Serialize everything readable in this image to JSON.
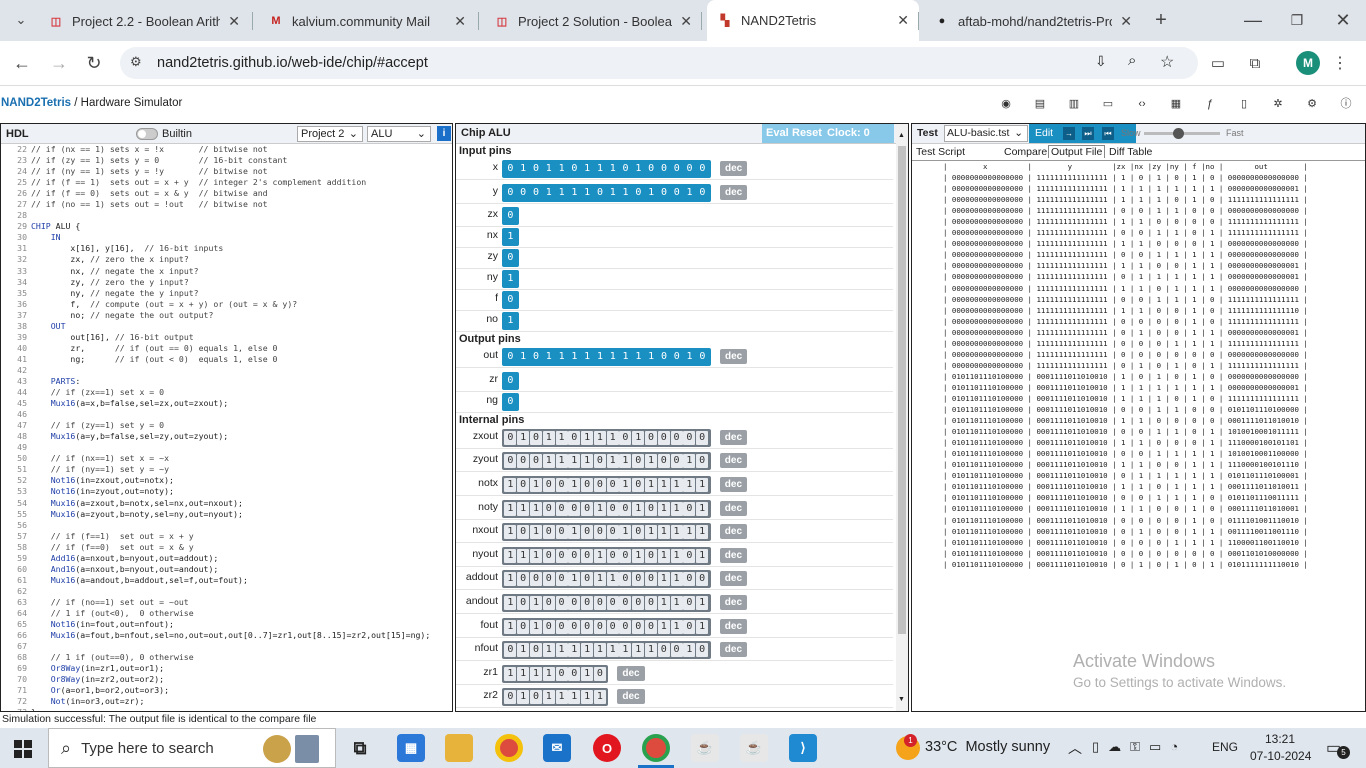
{
  "browser": {
    "tabs": [
      {
        "title": "Project 2.2 - Boolean Arithm",
        "icon": "pdf-icon"
      },
      {
        "title": "kalvium.community Mail",
        "icon": "gmail-icon"
      },
      {
        "title": "Project 2 Solution - Boolean",
        "icon": "pdf-icon"
      },
      {
        "title": "NAND2Tetris",
        "icon": "nand2tetris-icon"
      },
      {
        "title": "aftab-mohd/nand2tetris-Pro",
        "icon": "github-icon"
      }
    ],
    "url": "nand2tetris.github.io/web-ide/chip/#accept",
    "profile_initial": "M"
  },
  "app": {
    "brand": "NAND2Tetris",
    "separator": " / ",
    "subtitle": "Hardware Simulator"
  },
  "hdl": {
    "title": "HDL",
    "builtin_label": "Builtin",
    "project_select": "Project 2",
    "chip_select": "ALU",
    "lines": [
      {
        "n": "22",
        "t": "// if (nx == 1) sets x = !x       // bitwise not"
      },
      {
        "n": "23",
        "t": "// if (zy == 1) sets y = 0        // 16-bit constant"
      },
      {
        "n": "24",
        "t": "// if (ny == 1) sets y = !y       // bitwise not"
      },
      {
        "n": "25",
        "t": "// if (f == 1)  sets out = x + y  // integer 2's complement addition"
      },
      {
        "n": "26",
        "t": "// if (f == 0)  sets out = x & y  // bitwise and"
      },
      {
        "n": "27",
        "t": "// if (no == 1) sets out = !out   // bitwise not"
      },
      {
        "n": "28",
        "t": ""
      },
      {
        "n": "29",
        "t": "CHIP ALU {"
      },
      {
        "n": "30",
        "t": "    IN"
      },
      {
        "n": "31",
        "t": "        x[16], y[16],  // 16-bit inputs"
      },
      {
        "n": "32",
        "t": "        zx, // zero the x input?"
      },
      {
        "n": "33",
        "t": "        nx, // negate the x input?"
      },
      {
        "n": "34",
        "t": "        zy, // zero the y input?"
      },
      {
        "n": "35",
        "t": "        ny, // negate the y input?"
      },
      {
        "n": "36",
        "t": "        f,  // compute (out = x + y) or (out = x & y)?"
      },
      {
        "n": "37",
        "t": "        no; // negate the out output?"
      },
      {
        "n": "38",
        "t": "    OUT"
      },
      {
        "n": "39",
        "t": "        out[16], // 16-bit output"
      },
      {
        "n": "40",
        "t": "        zr,      // if (out == 0) equals 1, else 0"
      },
      {
        "n": "41",
        "t": "        ng;      // if (out < 0)  equals 1, else 0"
      },
      {
        "n": "42",
        "t": ""
      },
      {
        "n": "43",
        "t": "    PARTS:"
      },
      {
        "n": "44",
        "t": "    // if (zx==1) set x = 0"
      },
      {
        "n": "45",
        "t": "    Mux16(a=x,b=false,sel=zx,out=zxout);"
      },
      {
        "n": "46",
        "t": ""
      },
      {
        "n": "47",
        "t": "    // if (zy==1) set y = 0"
      },
      {
        "n": "48",
        "t": "    Mux16(a=y,b=false,sel=zy,out=zyout);"
      },
      {
        "n": "49",
        "t": ""
      },
      {
        "n": "50",
        "t": "    // if (nx==1) set x = ~x"
      },
      {
        "n": "51",
        "t": "    // if (ny==1) set y = ~y"
      },
      {
        "n": "52",
        "t": "    Not16(in=zxout,out=notx);"
      },
      {
        "n": "53",
        "t": "    Not16(in=zyout,out=noty);"
      },
      {
        "n": "54",
        "t": "    Mux16(a=zxout,b=notx,sel=nx,out=nxout);"
      },
      {
        "n": "55",
        "t": "    Mux16(a=zyout,b=noty,sel=ny,out=nyout);"
      },
      {
        "n": "56",
        "t": ""
      },
      {
        "n": "57",
        "t": "    // if (f==1)  set out = x + y"
      },
      {
        "n": "58",
        "t": "    // if (f==0)  set out = x & y"
      },
      {
        "n": "59",
        "t": "    Add16(a=nxout,b=nyout,out=addout);"
      },
      {
        "n": "60",
        "t": "    And16(a=nxout,b=nyout,out=andout);"
      },
      {
        "n": "61",
        "t": "    Mux16(a=andout,b=addout,sel=f,out=fout);"
      },
      {
        "n": "62",
        "t": ""
      },
      {
        "n": "63",
        "t": "    // if (no==1) set out = ~out"
      },
      {
        "n": "64",
        "t": "    // 1 if (out<0),  0 otherwise"
      },
      {
        "n": "65",
        "t": "    Not16(in=fout,out=nfout);"
      },
      {
        "n": "66",
        "t": "    Mux16(a=fout,b=nfout,sel=no,out=out,out[0..7]=zr1,out[8..15]=zr2,out[15]=ng);"
      },
      {
        "n": "67",
        "t": ""
      },
      {
        "n": "68",
        "t": "    // 1 if (out==0), 0 otherwise"
      },
      {
        "n": "69",
        "t": "    Or8Way(in=zr1,out=or1);"
      },
      {
        "n": "70",
        "t": "    Or8Way(in=zr2,out=or2);"
      },
      {
        "n": "71",
        "t": "    Or(a=or1,b=or2,out=or3);"
      },
      {
        "n": "72",
        "t": "    Not(in=or3,out=zr);"
      },
      {
        "n": "73",
        "t": "}"
      }
    ]
  },
  "chip": {
    "title": "Chip ALU",
    "eval": "Eval",
    "reset": "Reset",
    "clock": "Clock: 0",
    "input_title": "Input pins",
    "output_title": "Output pins",
    "internal_title": "Internal pins",
    "dec_label": "dec",
    "inputs": [
      {
        "name": "x",
        "bits": "0101101110100000",
        "dec": true
      },
      {
        "name": "y",
        "bits": "0001111011010010",
        "dec": true
      },
      {
        "name": "zx",
        "bits": "0",
        "dec": false
      },
      {
        "name": "nx",
        "bits": "1",
        "dec": false
      },
      {
        "name": "zy",
        "bits": "0",
        "dec": false
      },
      {
        "name": "ny",
        "bits": "1",
        "dec": false
      },
      {
        "name": "f",
        "bits": "0",
        "dec": false
      },
      {
        "name": "no",
        "bits": "1",
        "dec": false
      }
    ],
    "outputs": [
      {
        "name": "out",
        "bits": "0101111111110010",
        "dec": true
      },
      {
        "name": "zr",
        "bits": "0",
        "dec": false
      },
      {
        "name": "ng",
        "bits": "0",
        "dec": false
      }
    ],
    "internals": [
      {
        "name": "zxout",
        "bits": "0101101110100000"
      },
      {
        "name": "zyout",
        "bits": "0001111011010010"
      },
      {
        "name": "notx",
        "bits": "1010010001011111"
      },
      {
        "name": "noty",
        "bits": "1110000100101101"
      },
      {
        "name": "nxout",
        "bits": "1010010001011111"
      },
      {
        "name": "nyout",
        "bits": "1110000100101101"
      },
      {
        "name": "addout",
        "bits": "1000010110001100"
      },
      {
        "name": "andout",
        "bits": "1010000000001101"
      },
      {
        "name": "fout",
        "bits": "1010000000001101"
      },
      {
        "name": "nfout",
        "bits": "0101111111110010"
      },
      {
        "name": "zr1",
        "bits": "11110010"
      },
      {
        "name": "zr2",
        "bits": "01011111"
      }
    ]
  },
  "test": {
    "title": "Test",
    "file_select": "ALU-basic.tst",
    "edit": "Edit",
    "slow": "Slow",
    "fast": "Fast",
    "speed": 0.45,
    "tabs": [
      "Test Script",
      "Compare File",
      "Output File",
      "Diff Table"
    ],
    "header": "|        x         |        y         |zx |nx |zy |ny | f |no |       out        |",
    "rows": [
      "| 0000000000000000 | 1111111111111111 | 1 | 0 | 1 | 0 | 1 | 0 | 0000000000000000 |",
      "| 0000000000000000 | 1111111111111111 | 1 | 1 | 1 | 1 | 1 | 1 | 0000000000000001 |",
      "| 0000000000000000 | 1111111111111111 | 1 | 1 | 1 | 0 | 1 | 0 | 1111111111111111 |",
      "| 0000000000000000 | 1111111111111111 | 0 | 0 | 1 | 1 | 0 | 0 | 0000000000000000 |",
      "| 0000000000000000 | 1111111111111111 | 1 | 1 | 0 | 0 | 0 | 0 | 1111111111111111 |",
      "| 0000000000000000 | 1111111111111111 | 0 | 0 | 1 | 1 | 0 | 1 | 1111111111111111 |",
      "| 0000000000000000 | 1111111111111111 | 1 | 1 | 0 | 0 | 0 | 1 | 0000000000000000 |",
      "| 0000000000000000 | 1111111111111111 | 0 | 0 | 1 | 1 | 1 | 1 | 0000000000000000 |",
      "| 0000000000000000 | 1111111111111111 | 1 | 1 | 0 | 0 | 1 | 1 | 0000000000000001 |",
      "| 0000000000000000 | 1111111111111111 | 0 | 1 | 1 | 1 | 1 | 1 | 0000000000000001 |",
      "| 0000000000000000 | 1111111111111111 | 1 | 1 | 0 | 1 | 1 | 1 | 0000000000000000 |",
      "| 0000000000000000 | 1111111111111111 | 0 | 0 | 1 | 1 | 1 | 0 | 1111111111111111 |",
      "| 0000000000000000 | 1111111111111111 | 1 | 1 | 0 | 0 | 1 | 0 | 1111111111111110 |",
      "| 0000000000000000 | 1111111111111111 | 0 | 0 | 0 | 0 | 1 | 0 | 1111111111111111 |",
      "| 0000000000000000 | 1111111111111111 | 0 | 1 | 0 | 0 | 1 | 1 | 0000000000000001 |",
      "| 0000000000000000 | 1111111111111111 | 0 | 0 | 0 | 1 | 1 | 1 | 1111111111111111 |",
      "| 0000000000000000 | 1111111111111111 | 0 | 0 | 0 | 0 | 0 | 0 | 0000000000000000 |",
      "| 0000000000000000 | 1111111111111111 | 0 | 1 | 0 | 1 | 0 | 1 | 1111111111111111 |",
      "| 0101101110100000 | 0001111011010010 | 1 | 0 | 1 | 0 | 1 | 0 | 0000000000000000 |",
      "| 0101101110100000 | 0001111011010010 | 1 | 1 | 1 | 1 | 1 | 1 | 0000000000000001 |",
      "| 0101101110100000 | 0001111011010010 | 1 | 1 | 1 | 0 | 1 | 0 | 1111111111111111 |",
      "| 0101101110100000 | 0001111011010010 | 0 | 0 | 1 | 1 | 0 | 0 | 0101101110100000 |",
      "| 0101101110100000 | 0001111011010010 | 1 | 1 | 0 | 0 | 0 | 0 | 0001111011010010 |",
      "| 0101101110100000 | 0001111011010010 | 0 | 0 | 1 | 1 | 0 | 1 | 1010010001011111 |",
      "| 0101101110100000 | 0001111011010010 | 1 | 1 | 0 | 0 | 0 | 1 | 1110000100101101 |",
      "| 0101101110100000 | 0001111011010010 | 0 | 0 | 1 | 1 | 1 | 1 | 1010010001100000 |",
      "| 0101101110100000 | 0001111011010010 | 1 | 1 | 0 | 0 | 1 | 1 | 1110000100101110 |",
      "| 0101101110100000 | 0001111011010010 | 0 | 1 | 1 | 1 | 1 | 1 | 0101101110100001 |",
      "| 0101101110100000 | 0001111011010010 | 1 | 1 | 0 | 1 | 1 | 1 | 0001111011010011 |",
      "| 0101101110100000 | 0001111011010010 | 0 | 0 | 1 | 1 | 1 | 0 | 0101101110011111 |",
      "| 0101101110100000 | 0001111011010010 | 1 | 1 | 0 | 0 | 1 | 0 | 0001111011010001 |",
      "| 0101101110100000 | 0001111011010010 | 0 | 0 | 0 | 0 | 1 | 0 | 0111101001110010 |",
      "| 0101101110100000 | 0001111011010010 | 0 | 1 | 0 | 0 | 1 | 1 | 0011110011001110 |",
      "| 0101101110100000 | 0001111011010010 | 0 | 0 | 0 | 1 | 1 | 1 | 1100001100110010 |",
      "| 0101101110100000 | 0001111011010010 | 0 | 0 | 0 | 0 | 0 | 0 | 0001101010000000 |",
      "| 0101101110100000 | 0001111011010010 | 0 | 1 | 0 | 1 | 0 | 1 | 0101111111110010 |"
    ]
  },
  "watermark": {
    "line1": "Activate Windows",
    "line2": "Go to Settings to activate Windows."
  },
  "status": "Simulation successful: The output file is identical to the compare file",
  "taskbar": {
    "search_placeholder": "Type here to search",
    "weather": "33°C  Mostly sunny",
    "weather_badge": "1",
    "lang": "ENG",
    "time": "13:21",
    "date": "07-10-2024",
    "notif": "5"
  }
}
